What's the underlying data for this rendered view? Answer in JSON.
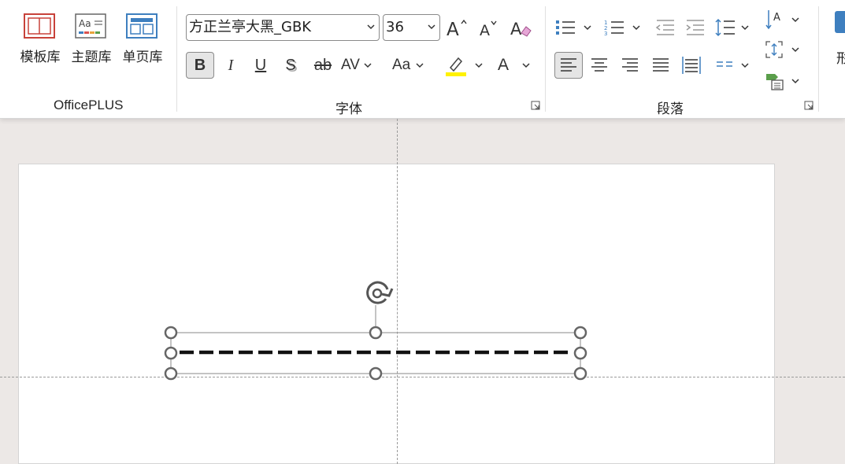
{
  "officeplus": {
    "group_label": "OfficePLUS",
    "buttons": [
      {
        "label": "模板库",
        "icon": "template-library-icon"
      },
      {
        "label": "主题库",
        "icon": "theme-library-icon"
      },
      {
        "label": "单页库",
        "icon": "single-page-library-icon"
      }
    ]
  },
  "font": {
    "group_label": "字体",
    "font_name": "方正兰亭大黑_GBK",
    "font_size": "36",
    "bold": "B",
    "italic": "I",
    "underline": "U",
    "shadow": "S",
    "strike": "ab",
    "spacing": "AV",
    "case": "Aa",
    "font_color_glyph": "A",
    "highlight_color": "#FFF200"
  },
  "paragraph": {
    "group_label": "段落"
  },
  "colors": {
    "accent": "#3E7FBF",
    "highlight": "#FFF200"
  },
  "right_edge_partial_label": "形"
}
